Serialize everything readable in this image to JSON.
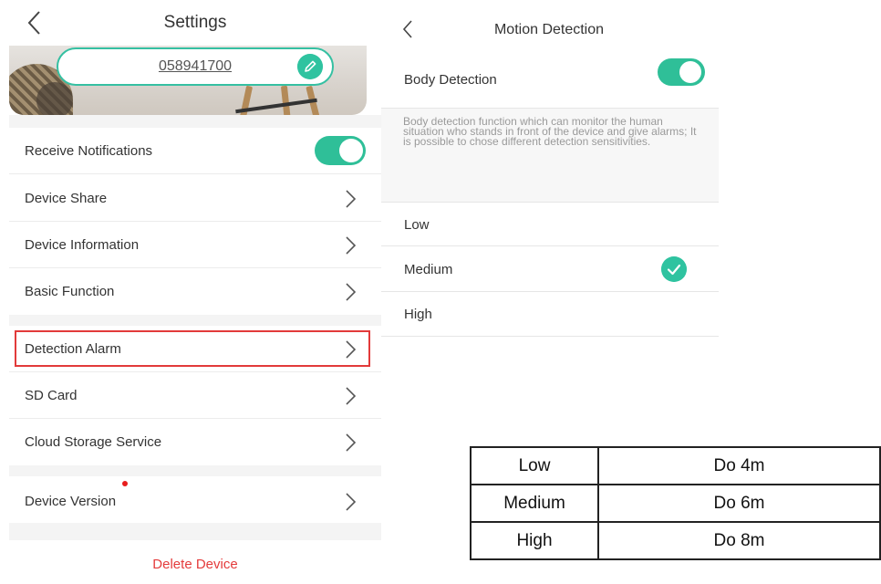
{
  "settings": {
    "title": "Settings",
    "serial": "058941700",
    "rows": [
      {
        "label": "Receive Notifications"
      },
      {
        "label": "Device Share"
      },
      {
        "label": "Device Information"
      },
      {
        "label": "Basic Function"
      },
      {
        "label": "Detection Alarm"
      },
      {
        "label": "SD Card"
      },
      {
        "label": "Cloud Storage Service"
      },
      {
        "label": "Device Version"
      }
    ],
    "delete_label": "Delete Device",
    "accent": "#2fc3a0",
    "highlight_color": "#e23a3a"
  },
  "motion": {
    "title": "Motion Detection",
    "body_detection_label": "Body Detection",
    "description": "Body detection function which can monitor the human situation who stands in front of the device and give alarms; It is possible to chose different detection sensitivities.",
    "levels": [
      {
        "label": "Low"
      },
      {
        "label": "Medium",
        "selected": true
      },
      {
        "label": "High"
      }
    ]
  },
  "range_table": [
    {
      "level": "Low",
      "range": "Do 4m"
    },
    {
      "level": "Medium",
      "range": "Do 6m"
    },
    {
      "level": "High",
      "range": "Do 8m"
    }
  ],
  "icons": [
    "back-chevron-icon",
    "edit-pencil-icon",
    "chevron-right-icon",
    "check-icon"
  ]
}
